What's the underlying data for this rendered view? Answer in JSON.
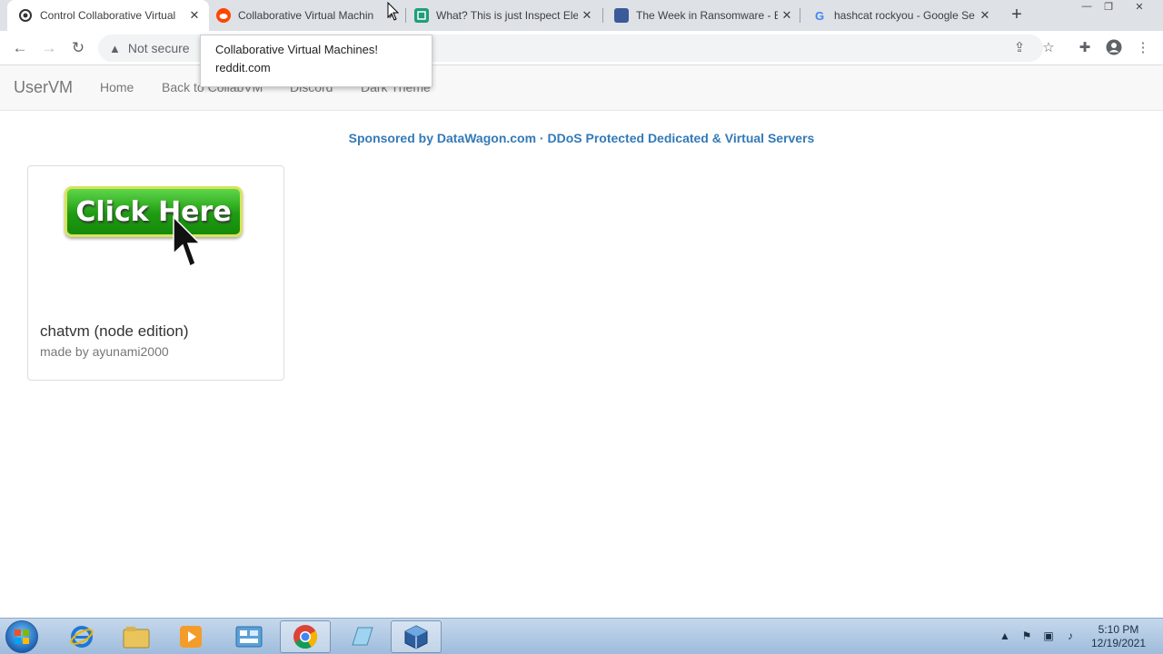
{
  "browser": {
    "tabs": [
      {
        "title": "Control Collaborative Virtual",
        "favicon": "collabvm-icon"
      },
      {
        "title": "Collaborative Virtual Machin",
        "favicon": "reddit-icon"
      },
      {
        "title": "What? This is just Inspect Ele",
        "favicon": "inspect-icon"
      },
      {
        "title": "The Week in Ransomware - B",
        "favicon": "bleeping-icon"
      },
      {
        "title": "hashcat rockyou - Google Se",
        "favicon": "google-icon"
      }
    ],
    "address": {
      "security_label": "Not secure"
    },
    "tooltip": {
      "title": "Collaborative Virtual Machines!",
      "url": "reddit.com"
    }
  },
  "navbar": {
    "brand": "UserVM",
    "links": [
      "Home",
      "Back to CollabVM",
      "Discord",
      "Dark Theme"
    ]
  },
  "sponsor": "Sponsored by DataWagon.com · DDoS Protected Dedicated & Virtual Servers",
  "card": {
    "button_text": "Click Here",
    "title": "chatvm (node edition)",
    "author": "made by ayunami2000"
  },
  "taskbar": {
    "time": "5:10 PM",
    "date": "12/19/2021"
  },
  "colors": {
    "link": "#337ab7",
    "navbar_bg": "#f8f8f8",
    "tabstrip_bg": "#dee1e6"
  }
}
